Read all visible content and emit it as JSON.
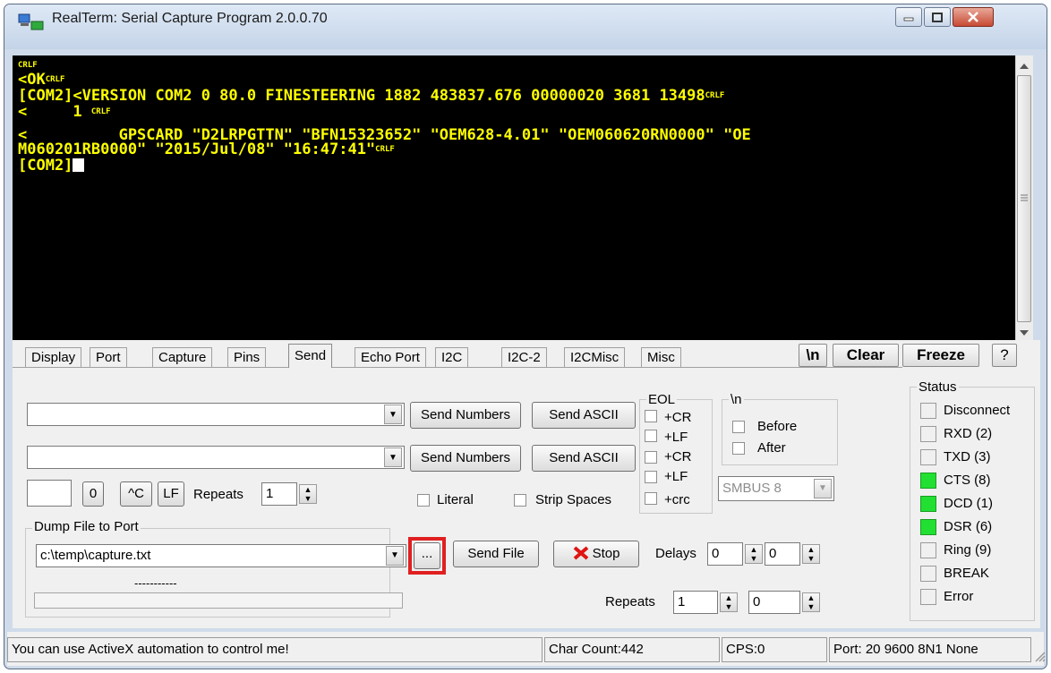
{
  "window": {
    "title": "RealTerm: Serial Capture Program 2.0.0.70"
  },
  "terminal": {
    "lines": [
      {
        "text": "",
        "crlf": "CRLF"
      },
      {
        "text": "<OK",
        "crlf": "CRLF"
      },
      {
        "text": "[COM2]<VERSION COM2 0 80.0 FINESTEERING 1882 483837.676 00000020 3681 13498",
        "crlf": "CRLF"
      },
      {
        "text": "<     1 ",
        "crlf": "CRLF"
      },
      {
        "text": "<          GPSCARD \"D2LRPGTTN\" \"BFN15323652\" \"OEM628-4.01\" \"OEM060620RN0000\" \"OE",
        "crlf": ""
      },
      {
        "text": "M060201RB0000\" \"2015/Jul/08\" \"16:47:41\"",
        "crlf": "CRLF"
      },
      {
        "text": "[COM2]",
        "crlf": ""
      }
    ]
  },
  "tabs": [
    "Display",
    "Port",
    "Capture",
    "Pins",
    "Send",
    "Echo Port",
    "I2C",
    "I2C-2",
    "I2CMisc",
    "Misc"
  ],
  "toolbar": {
    "newline": "\\n",
    "clear": "Clear",
    "freeze": "Freeze",
    "help": "?"
  },
  "send": {
    "send_numbers": "Send Numbers",
    "send_ascii": "Send ASCII",
    "zero": "0",
    "ctrl_c": "^C",
    "lf": "LF",
    "repeats_label": "Repeats",
    "repeats_value": "1",
    "literal": "Literal",
    "strip_spaces": "Strip Spaces"
  },
  "eol": {
    "title": "EOL",
    "cr": "+CR",
    "lf": "+LF",
    "crc": "+crc"
  },
  "nl_group": {
    "title": "\\n",
    "before": "Before",
    "after": "After"
  },
  "smbus": {
    "value": "SMBUS 8"
  },
  "dump": {
    "title": "Dump File to Port",
    "file": "c:\\temp\\capture.txt",
    "browse": "...",
    "send_file": "Send File",
    "stop": "Stop",
    "delays_label": "Delays",
    "delay1": "0",
    "delay2": "0",
    "progress_text": "-----------",
    "repeats_label": "Repeats",
    "repeats1": "1",
    "repeats2": "0"
  },
  "status": {
    "title": "Status",
    "items": [
      {
        "label": "Disconnect",
        "on": false
      },
      {
        "label": "RXD (2)",
        "on": false
      },
      {
        "label": "TXD (3)",
        "on": false
      },
      {
        "label": "CTS (8)",
        "on": true
      },
      {
        "label": "DCD (1)",
        "on": true
      },
      {
        "label": "DSR (6)",
        "on": true
      },
      {
        "label": "Ring (9)",
        "on": false
      },
      {
        "label": "BREAK",
        "on": false
      },
      {
        "label": "Error",
        "on": false
      }
    ],
    "on_color": "#22e032"
  },
  "statusbar": {
    "message": "You can use ActiveX automation to control me!",
    "char_count": "Char Count:442",
    "cps": "CPS:0",
    "port": "Port: 20 9600 8N1 None"
  },
  "highlight_color": "#e02020"
}
